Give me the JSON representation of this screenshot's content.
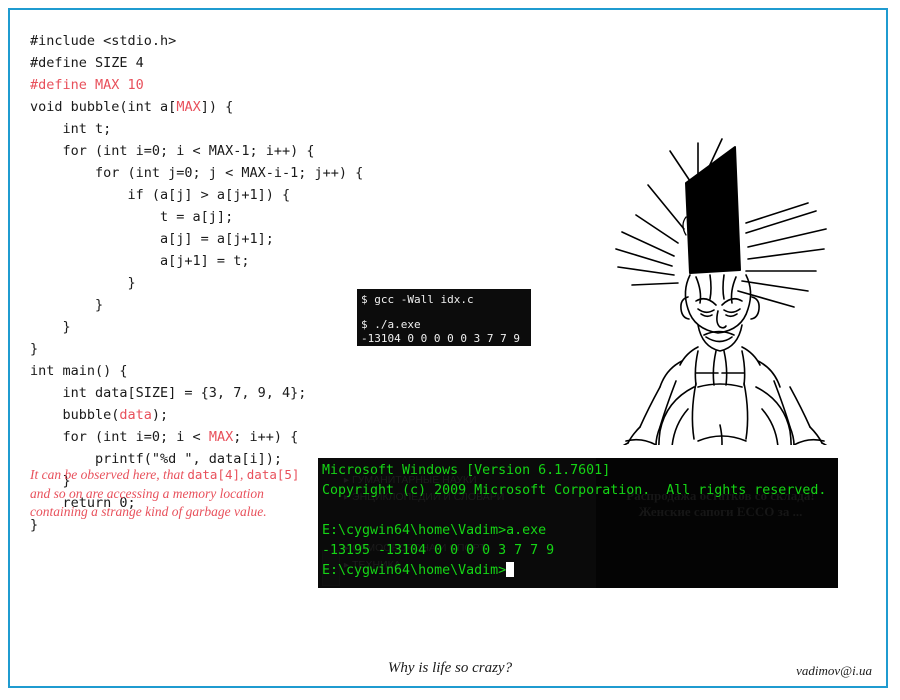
{
  "page": {
    "background": "#ffffff",
    "border_color": "#1f9bd0",
    "accent_red": "#e8505b",
    "console_green": "#15d615"
  },
  "code": {
    "language": "c",
    "lines": [
      [
        {
          "t": "#include <stdio.h>",
          "c": "plain"
        }
      ],
      [
        {
          "t": "#define SIZE 4",
          "c": "plain"
        }
      ],
      [
        {
          "t": "#define MAX 10",
          "c": "kw"
        }
      ],
      [
        {
          "t": "void bubble(int a[",
          "c": "plain"
        },
        {
          "t": "MAX",
          "c": "kw"
        },
        {
          "t": "]) {",
          "c": "plain"
        }
      ],
      [
        {
          "t": "    int t;",
          "c": "plain"
        }
      ],
      [
        {
          "t": "    for (int i=0; i < MAX-1; i++) {",
          "c": "plain"
        }
      ],
      [
        {
          "t": "        for (int j=0; j < MAX-i-1; j++) {",
          "c": "plain"
        }
      ],
      [
        {
          "t": "            if (a[j] > a[j+1]) {",
          "c": "plain"
        }
      ],
      [
        {
          "t": "                t = a[j];",
          "c": "plain"
        }
      ],
      [
        {
          "t": "                a[j] = a[j+1];",
          "c": "plain"
        }
      ],
      [
        {
          "t": "                a[j+1] = t;",
          "c": "plain"
        }
      ],
      [
        {
          "t": "            }",
          "c": "plain"
        }
      ],
      [
        {
          "t": "        }",
          "c": "plain"
        }
      ],
      [
        {
          "t": "    }",
          "c": "plain"
        }
      ],
      [
        {
          "t": "}",
          "c": "plain"
        }
      ],
      [
        {
          "t": "int main() {",
          "c": "plain"
        }
      ],
      [
        {
          "t": "    int data[SIZE] = {3, 7, 9, 4};",
          "c": "plain"
        }
      ],
      [
        {
          "t": "    bubble(",
          "c": "plain"
        },
        {
          "t": "data",
          "c": "kw"
        },
        {
          "t": ");",
          "c": "plain"
        }
      ],
      [
        {
          "t": "    for (int i=0; i < ",
          "c": "plain"
        },
        {
          "t": "MAX",
          "c": "kw"
        },
        {
          "t": "; i++) {",
          "c": "plain"
        }
      ],
      [
        {
          "t": "        printf(\"%d \", data[i]);",
          "c": "plain"
        }
      ],
      [
        {
          "t": "    }",
          "c": "plain"
        }
      ],
      [
        {
          "t": "    return 0;",
          "c": "plain"
        }
      ],
      [
        {
          "t": "}",
          "c": "plain"
        }
      ]
    ]
  },
  "mini_terminal": {
    "lines": [
      "$ gcc -Wall idx.c",
      "",
      "$ ./a.exe",
      "-13104 0 0 0 0 0 3 7 7 9"
    ]
  },
  "console": {
    "lines": [
      "Microsoft Windows [Version 6.1.7601]",
      "Copyright (c) 2009 Microsoft Corporation.  All rights reserved.",
      "",
      "E:\\cygwin64\\home\\Vadim>a.exe",
      "-13195 -13104 0 0 0 0 3 7 7 9"
    ],
    "prompt": "E:\\cygwin64\\home\\Vadim>",
    "ghost_menu": "  ▸ ГУМАНИТАРНЫЕ НАУКИ\n  ▸ ЭНЦИКЛОПЕДИИ И СЛОВАРИ\n\n\n  ▸ САМООБОРОНА И СПОРТ\n  ▸ ТЕХНИКА",
    "ghost_ad": "Распродажа остатков со склада! Женские сапоги ECCO за ..."
  },
  "annotation": {
    "part1": "It can be observed here, that ",
    "mono1": "data[4]",
    "part2": ", ",
    "mono2": "data[5]",
    "part3": " and so on are accessing a memory location containing a strange kind of garbage value."
  },
  "illustration": {
    "name": "man-with-black-bucket-on-head",
    "alt": "Line drawing of a squatting frustrated man with a large black wedge over his head and radiating impact lines"
  },
  "footer": {
    "caption": "Why is life so crazy?",
    "signature": "vadimov@i.ua"
  }
}
